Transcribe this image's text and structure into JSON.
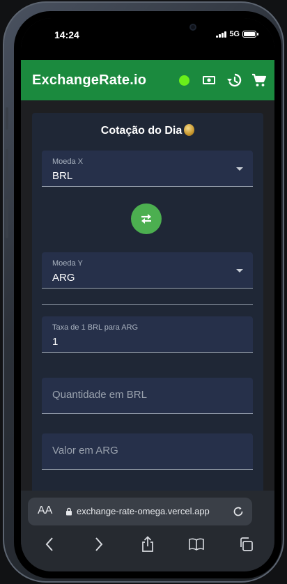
{
  "status_bar": {
    "time": "14:24",
    "network": "5G"
  },
  "app": {
    "title": "ExchangeRate.io",
    "online_dot_color": "#6aef1a",
    "accent_color": "#1b8a3e",
    "icons": [
      "money-icon",
      "history-icon",
      "cart-icon"
    ]
  },
  "card": {
    "title": "Cotação do Dia",
    "currency_x": {
      "label": "Moeda X",
      "value": "BRL"
    },
    "currency_y": {
      "label": "Moeda Y",
      "value": "ARG"
    },
    "rate": {
      "label": "Taxa de 1 BRL para ARG",
      "value": "1"
    },
    "amount": {
      "placeholder": "Quantidade em BRL"
    },
    "result": {
      "placeholder": "Valor em ARG"
    }
  },
  "browser": {
    "aa_label": "AA",
    "url": "exchange-rate-omega.vercel.app"
  }
}
